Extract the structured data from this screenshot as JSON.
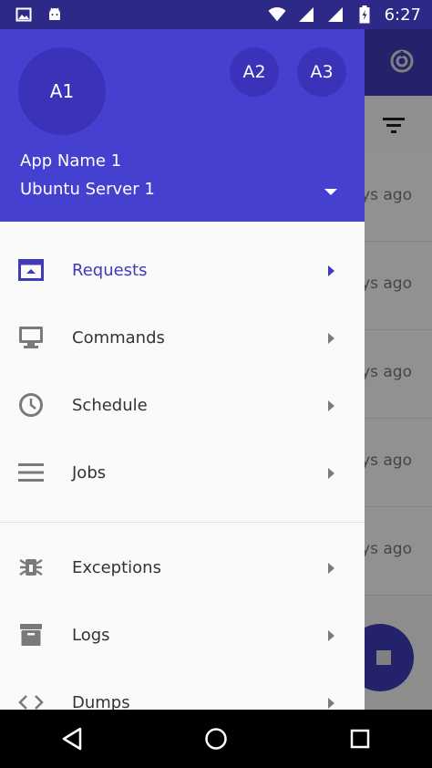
{
  "status_bar": {
    "time": "6:27",
    "icons": [
      "image-icon",
      "android-icon",
      "wifi-icon",
      "signal-icon",
      "signal-icon",
      "battery-charging-icon"
    ]
  },
  "background": {
    "row_texts": [
      "ys ago",
      "ys ago",
      "ys ago",
      "ys ago",
      "ys ago"
    ]
  },
  "drawer": {
    "header": {
      "avatar_main": "A1",
      "avatar_2": "A2",
      "avatar_3": "A3",
      "app_name": "App Name 1",
      "server_name": "Ubuntu Server 1"
    },
    "items": [
      {
        "label": "Requests",
        "icon": "requests-icon",
        "active": true
      },
      {
        "label": "Commands",
        "icon": "monitor-icon"
      },
      {
        "label": "Schedule",
        "icon": "clock-icon"
      },
      {
        "label": "Jobs",
        "icon": "menu-lines-icon"
      },
      {
        "label": "Exceptions",
        "icon": "bug-icon"
      },
      {
        "label": "Logs",
        "icon": "archive-icon"
      },
      {
        "label": "Dumps",
        "icon": "code-icon"
      }
    ]
  },
  "colors": {
    "primary": "#4540d0",
    "primary_dark": "#2c2a86",
    "accent_active": "#3f3bb7",
    "icon_grey": "#7a7a7a"
  }
}
